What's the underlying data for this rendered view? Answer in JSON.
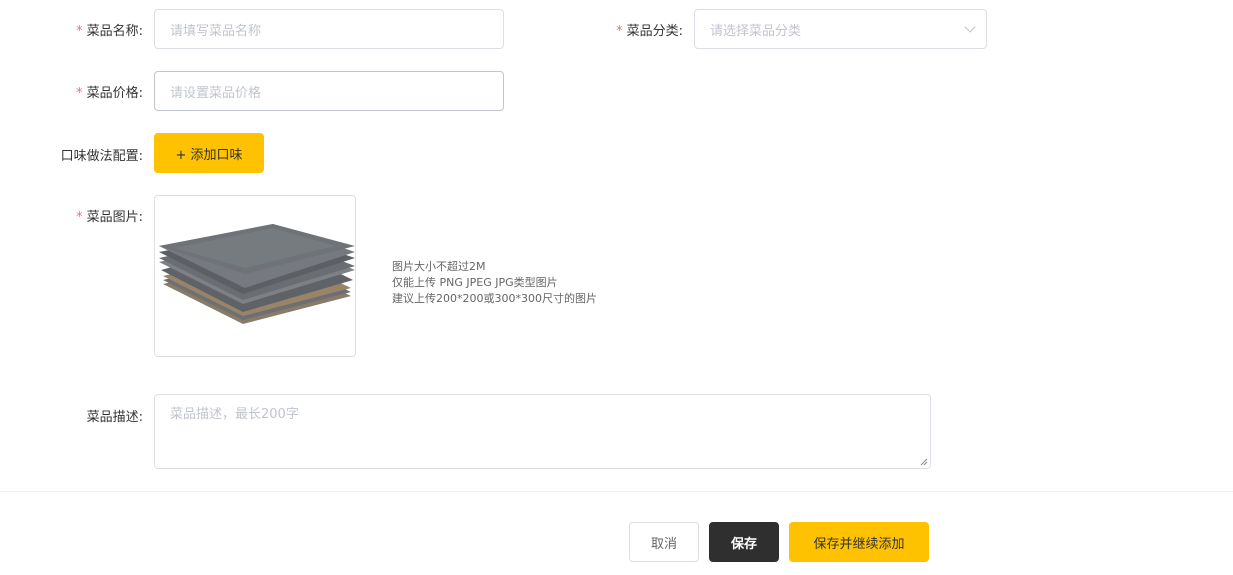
{
  "form": {
    "name": {
      "label": "菜品名称:",
      "placeholder": "请填写菜品名称",
      "required": true
    },
    "category": {
      "label": "菜品分类:",
      "placeholder": "请选择菜品分类",
      "required": true
    },
    "price": {
      "label": "菜品价格:",
      "placeholder": "请设置菜品价格",
      "required": true
    },
    "flavor": {
      "label": "口味做法配置:",
      "button": "+ 添加口味"
    },
    "image": {
      "label": "菜品图片:",
      "required": true,
      "tips": [
        "图片大小不超过2M",
        "仅能上传 PNG JPEG JPG类型图片",
        "建议上传200*200或300*300尺寸的图片"
      ]
    },
    "description": {
      "label": "菜品描述:",
      "placeholder": "菜品描述，最长200字"
    },
    "required_mark": "*"
  },
  "footer": {
    "cancel": "取消",
    "save": "保存",
    "save_continue": "保存并继续添加"
  },
  "icons": {
    "category_dropdown": "chevron-down-icon",
    "resize": "resize-handle-icon"
  },
  "colors": {
    "accent": "#ffc200",
    "dark": "#2f2f2f",
    "required": "#f56c6c"
  }
}
